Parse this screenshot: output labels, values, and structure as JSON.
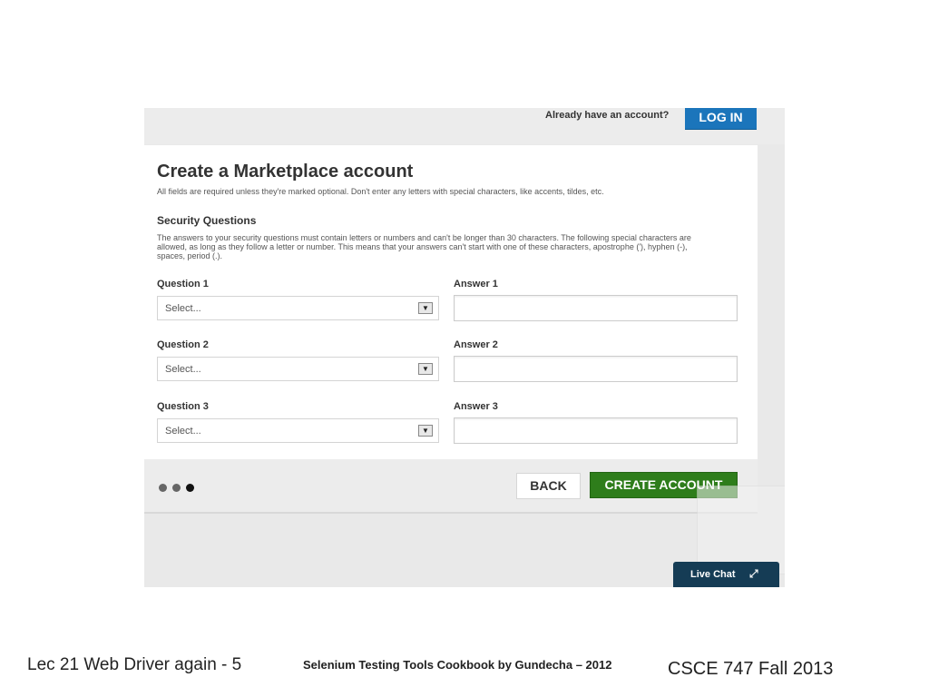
{
  "header": {
    "already_text": "Already have an account?",
    "login_label": "LOG IN"
  },
  "form": {
    "title": "Create a Marketplace account",
    "subtitle": "All fields are required unless they're marked optional. Don't enter any letters with special characters, like accents, tildes, etc.",
    "section_title": "Security Questions",
    "section_text": "The answers to your security questions must contain letters or numbers and can't be longer than 30 characters. The following special characters are allowed, as long as they follow a letter or number. This means that your answers can't start with one of these characters, apostrophe ('), hyphen (-), spaces, period (.).",
    "questions": [
      {
        "question_label": "Question 1",
        "select_value": "Select...",
        "answer_label": "Answer 1",
        "answer_value": ""
      },
      {
        "question_label": "Question 2",
        "select_value": "Select...",
        "answer_label": "Answer 2",
        "answer_value": ""
      },
      {
        "question_label": "Question 3",
        "select_value": "Select...",
        "answer_label": "Answer 3",
        "answer_value": ""
      }
    ]
  },
  "footer": {
    "step_count": 3,
    "current_step": 3,
    "back_label": "BACK",
    "create_label": "CREATE ACCOUNT"
  },
  "chat": {
    "label": "Live Chat",
    "icon": "expand-icon"
  },
  "slide": {
    "left_text": "Lec 21 Web Driver again - 5",
    "center_text": "Selenium Testing Tools Cookbook by Gundecha – 2012",
    "right_text": "CSCE 747 Fall 2013"
  },
  "colors": {
    "login_blue": "#1b75bb",
    "create_green": "#2e7d1b",
    "chat_navy": "#153c55",
    "dot_inactive": "#666666",
    "dot_active": "#111111"
  }
}
